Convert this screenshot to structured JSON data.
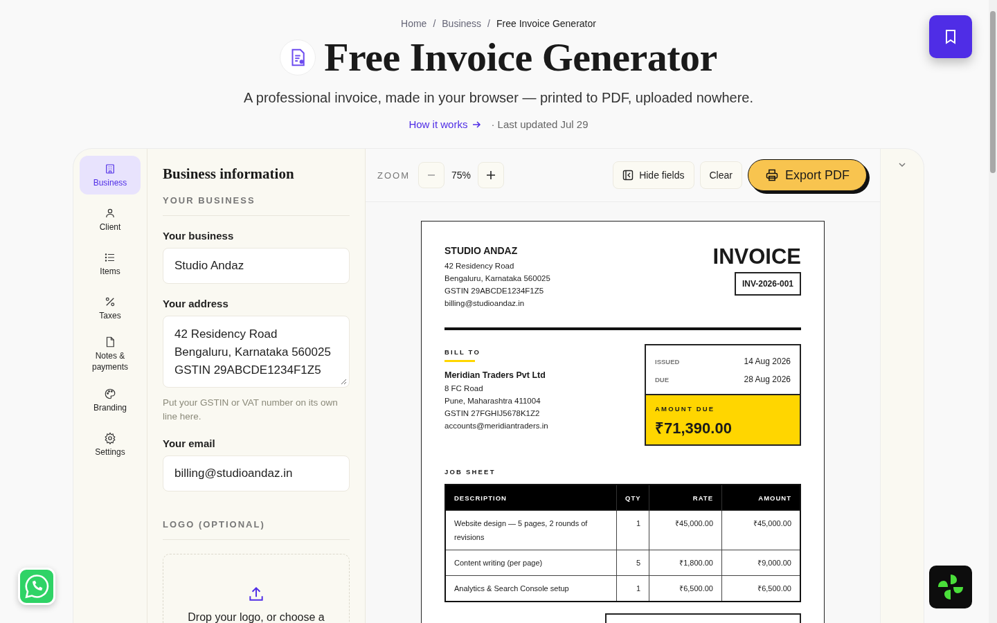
{
  "breadcrumb": {
    "separator": "/",
    "items": [
      {
        "label": "Home",
        "current": false
      },
      {
        "label": "Business",
        "current": false
      },
      {
        "label": "Free Invoice Generator",
        "current": true
      }
    ]
  },
  "title": "Free Invoice Generator",
  "subtitle": "A professional invoice, made in your browser — printed to PDF, uploaded nowhere.",
  "how_it_works": "How it works",
  "last_updated": "· Last updated Jul 29",
  "sidebar": {
    "items": [
      {
        "label": "Business",
        "selected": true
      },
      {
        "label": "Client",
        "selected": false
      },
      {
        "label": "Items",
        "selected": false
      },
      {
        "label": "Taxes",
        "selected": false
      },
      {
        "label": "Notes & payments",
        "selected": false
      },
      {
        "label": "Branding",
        "selected": false
      },
      {
        "label": "Settings",
        "selected": false
      }
    ]
  },
  "form": {
    "heading": "Business information",
    "section": "YOUR BUSINESS",
    "fields": [
      {
        "kind": "input",
        "label": "Your business",
        "value": "Studio Andaz"
      },
      {
        "kind": "textarea",
        "label": "Your address",
        "value": "42 Residency Road\nBengaluru, Karnataka 560025\nGSTIN 29ABCDE1234F1Z5",
        "hint": "Put your GSTIN or VAT number on its own line here."
      },
      {
        "kind": "input",
        "label": "Your email",
        "value": "billing@studioandaz.in"
      }
    ],
    "logo_section": "LOGO (OPTIONAL)",
    "drop_text": "Drop your logo, or choose a"
  },
  "toolbar": {
    "zoom_label": "ZOOM",
    "zoom_value": "75%",
    "hide_fields": "Hide fields",
    "clear": "Clear",
    "export": "Export PDF"
  },
  "invoice": {
    "from_name": "STUDIO ANDAZ",
    "from_lines": [
      "42 Residency Road",
      "Bengaluru, Karnataka 560025",
      "GSTIN 29ABCDE1234F1Z5",
      "billing@studioandaz.in"
    ],
    "title": "INVOICE",
    "number": "INV-2026-001",
    "bill_to_label": "BILL TO",
    "client_name": "Meridian Traders Pvt Ltd",
    "client_lines": [
      "8 FC Road",
      "Pune, Maharashtra 411004",
      "GSTIN 27FGHIJ5678K1Z2",
      "accounts@meridiantraders.in"
    ],
    "dates": [
      {
        "label": "ISSUED",
        "value": "14 Aug 2026"
      },
      {
        "label": "DUE",
        "value": "28 Aug 2026"
      }
    ],
    "amount_due_label": "AMOUNT DUE",
    "amount_due": "₹71,390.00",
    "job_sheet_label": "JOB SHEET",
    "table": {
      "columns": [
        "DESCRIPTION",
        "QTY",
        "RATE",
        "AMOUNT"
      ],
      "rows": [
        [
          "Website design — 5 pages, 2 rounds of revisions",
          "1",
          "₹45,000.00",
          "₹45,000.00"
        ],
        [
          "Content writing (per page)",
          "5",
          "₹1,800.00",
          "₹9,000.00"
        ],
        [
          "Analytics & Search Console setup",
          "1",
          "₹6,500.00",
          "₹6,500.00"
        ]
      ]
    }
  }
}
